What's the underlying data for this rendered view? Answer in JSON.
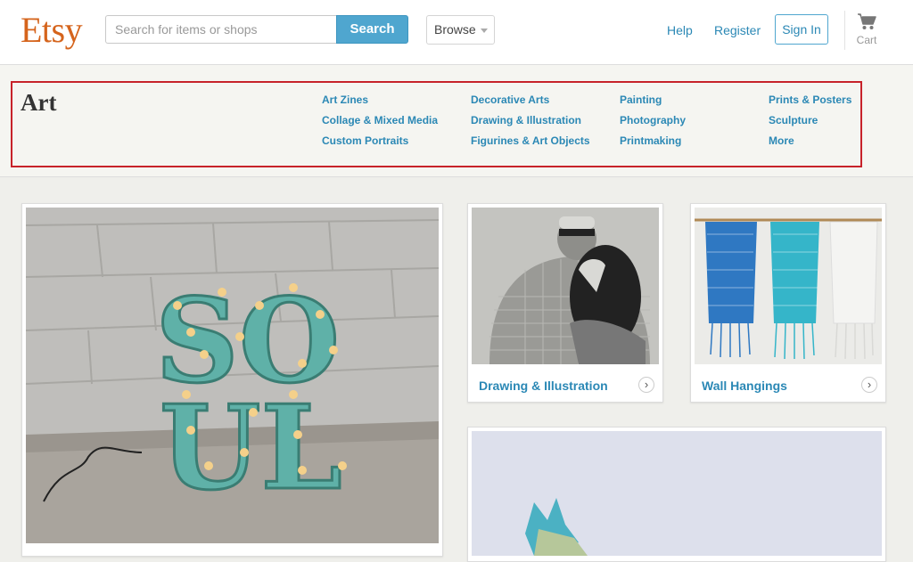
{
  "header": {
    "logo": "Etsy",
    "search": {
      "placeholder": "Search for items or shops",
      "button": "Search"
    },
    "browse": "Browse",
    "links": [
      "Help",
      "Register"
    ],
    "signin": "Sign In",
    "cart": "Cart"
  },
  "category": {
    "title": "Art",
    "columns": [
      [
        "Art Zines",
        "Collage & Mixed Media",
        "Custom Portraits"
      ],
      [
        "Decorative Arts",
        "Drawing & Illustration",
        "Figurines & Art Objects"
      ],
      [
        "Painting",
        "Photography",
        "Printmaking"
      ],
      [
        "Prints & Posters",
        "Sculpture",
        "More"
      ]
    ]
  },
  "tiles": [
    {
      "label": "Drawing & Illustration",
      "icon": "chevron-right-icon"
    },
    {
      "label": "Wall Hangings",
      "icon": "chevron-right-icon"
    }
  ],
  "colors": {
    "brand": "#d5641c",
    "accent": "#4fa6cf",
    "link": "#2b88b5",
    "highlight_border": "#c7222a"
  }
}
